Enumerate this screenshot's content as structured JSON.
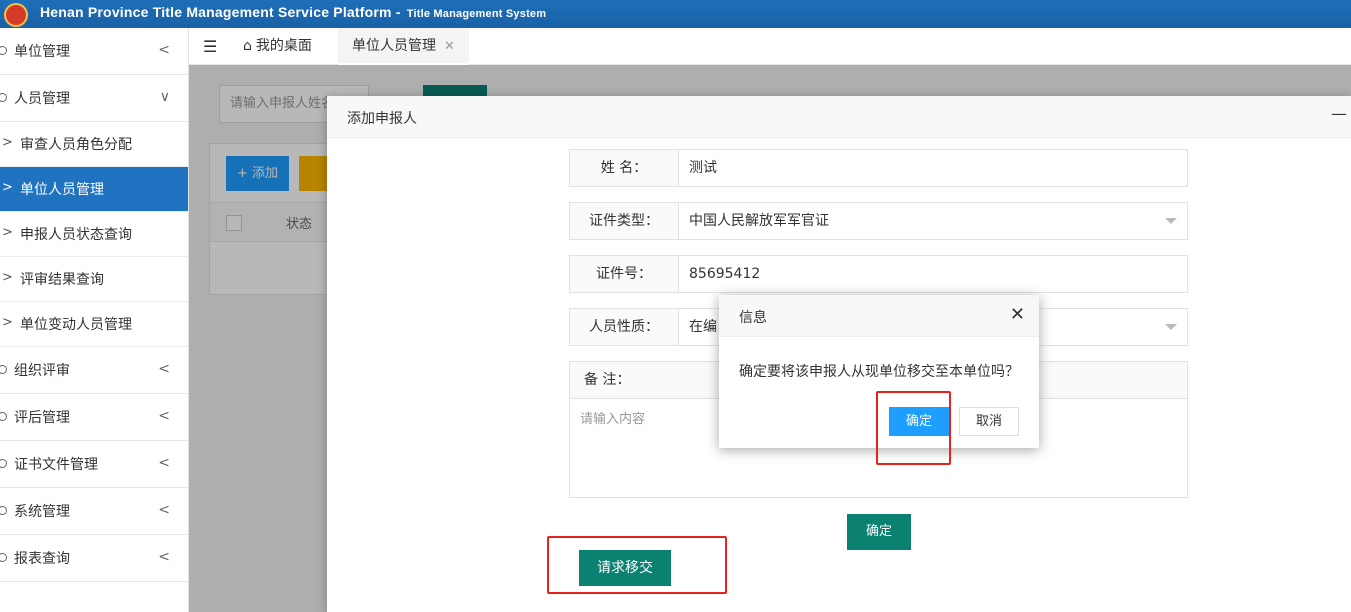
{
  "header": {
    "title": "Henan Province Title Management Service Platform -",
    "subtitle": "Title Management System"
  },
  "sidebar": {
    "items": [
      {
        "label": "单位管理"
      },
      {
        "label": "人员管理"
      },
      {
        "label": "审查人员角色分配"
      },
      {
        "label": "单位人员管理"
      },
      {
        "label": "申报人员状态查询"
      },
      {
        "label": "评审结果查询"
      },
      {
        "label": "单位变动人员管理"
      },
      {
        "label": "组织评审"
      },
      {
        "label": "评后管理"
      },
      {
        "label": "证书文件管理"
      },
      {
        "label": "系统管理"
      },
      {
        "label": "报表查询"
      }
    ]
  },
  "tabs": {
    "home": "我的桌面",
    "current": "单位人员管理"
  },
  "main": {
    "search_placeholder": "请输入申报人姓名",
    "add_label": "添加",
    "col_status": "状态"
  },
  "modal": {
    "title": "添加申报人",
    "fields": [
      {
        "label": "姓 名：",
        "value": "测试"
      },
      {
        "label": "证件类型：",
        "value": "中国人民解放军军官证"
      },
      {
        "label": "证件号：",
        "value": "85695412"
      },
      {
        "label": "人员性质：",
        "value": "在编"
      }
    ],
    "remark_label": "备 注：",
    "remark_placeholder": "请输入内容",
    "confirm_label": "确定",
    "transfer_label": "请求移交"
  },
  "dialog": {
    "title": "信息",
    "message": "确定要将该申报人从现单位移交至本单位吗？",
    "ok_label": "确定",
    "cancel_label": "取消"
  }
}
